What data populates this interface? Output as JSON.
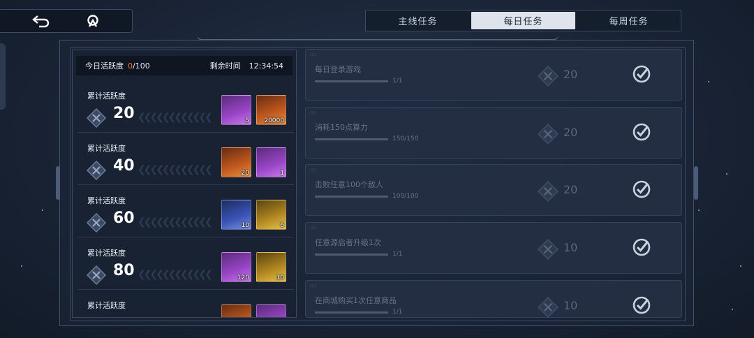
{
  "tabs": [
    {
      "label": "主线任务",
      "active": false
    },
    {
      "label": "每日任务",
      "active": true
    },
    {
      "label": "每周任务",
      "active": false
    }
  ],
  "activity": {
    "label": "今日活跃度",
    "current": "0",
    "max": "/100",
    "remaining_label": "剩余时间",
    "remaining_time": "12:34:54"
  },
  "milestones": [
    {
      "label": "累计活跃度",
      "value": "20",
      "rewards": [
        {
          "icon": "purple-manual-item",
          "count": "5"
        },
        {
          "icon": "orange-credit-chips",
          "count": "20000"
        }
      ]
    },
    {
      "label": "累计活跃度",
      "value": "40",
      "rewards": [
        {
          "icon": "orange-star-crystal",
          "count": "20"
        },
        {
          "icon": "purple-supply-chest",
          "count": "1"
        }
      ]
    },
    {
      "label": "累计活跃度",
      "value": "60",
      "rewards": [
        {
          "icon": "blue-crystal-shard",
          "count": "10"
        },
        {
          "icon": "gold-battery-cell",
          "count": "6"
        }
      ]
    },
    {
      "label": "累计活跃度",
      "value": "80",
      "rewards": [
        {
          "icon": "purple-orbit-core",
          "count": "120"
        },
        {
          "icon": "gold-energy-cube",
          "count": "10"
        }
      ]
    },
    {
      "label": "累计活跃度",
      "value": "",
      "rewards": [
        {
          "icon": "orange-ticket",
          "count": ""
        },
        {
          "icon": "purple-pen-item",
          "count": ""
        }
      ]
    }
  ],
  "tasks": [
    {
      "name": "每日登录游戏",
      "progress": "1/1",
      "fill": 1.0,
      "points": "20",
      "completed": true
    },
    {
      "name": "消耗150点算力",
      "progress": "150/150",
      "fill": 1.0,
      "points": "20",
      "completed": true
    },
    {
      "name": "击败任意100个敌人",
      "progress": "100/100",
      "fill": 1.0,
      "points": "20",
      "completed": true
    },
    {
      "name": "任意源启者升级1次",
      "progress": "1/1",
      "fill": 1.0,
      "points": "10",
      "completed": true
    },
    {
      "name": "在商城购买1次任意商品",
      "progress": "1/1",
      "fill": 1.0,
      "points": "10",
      "completed": true
    }
  ],
  "colors": {
    "accent_orange": "#ff6b3a",
    "tab_active_bg": "#dfe4ec"
  },
  "icons": {
    "back": "back-arrow-icon",
    "home": "home-emblem-icon",
    "activity": "activity-diamond-icon",
    "done": "check-circle-icon"
  }
}
